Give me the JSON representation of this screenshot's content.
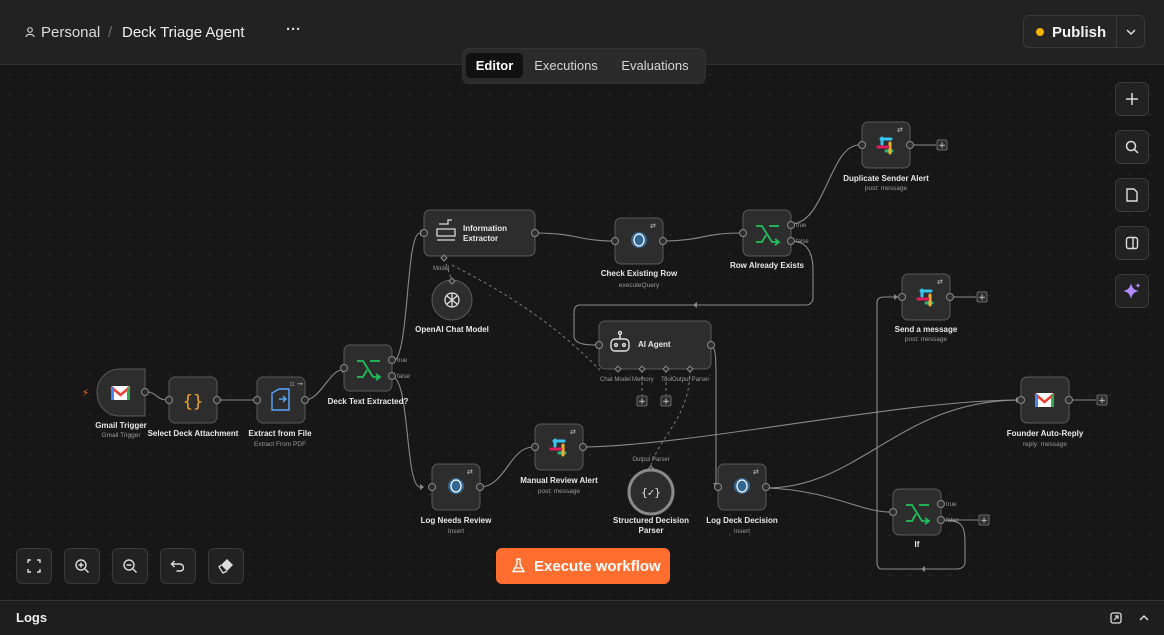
{
  "header": {
    "workspace_label": "Personal",
    "separator": "/",
    "workflow_name": "Deck Triage Agent",
    "more_label": "···",
    "publish_label": "Publish",
    "publish_status_color": "#f5b400"
  },
  "tabs": [
    {
      "label": "Editor",
      "active": true
    },
    {
      "label": "Executions",
      "active": false
    },
    {
      "label": "Evaluations",
      "active": false
    }
  ],
  "nodes": {
    "gmail_trigger": {
      "label": "Gmail Trigger",
      "sub": "Gmail Trigger",
      "icon": "gmail-icon"
    },
    "select_deck": {
      "label": "Select Deck Attachment",
      "icon": "code-braces-icon"
    },
    "extract_file": {
      "label": "Extract from File",
      "sub": "Extract From PDF",
      "icon": "file-extract-icon"
    },
    "deck_text_if": {
      "label": "Deck Text Extracted?",
      "icon": "if-branch-icon",
      "ports": [
        "true",
        "false"
      ]
    },
    "info_extractor": {
      "label1": "Information",
      "label2": "Extractor",
      "icon": "extractor-icon",
      "port": "Model"
    },
    "openai_model": {
      "label": "OpenAI Chat Model",
      "icon": "openai-icon"
    },
    "check_row": {
      "label": "Check Existing Row",
      "sub": "executeQuery",
      "icon": "postgres-icon"
    },
    "row_exists_if": {
      "label": "Row Already Exists",
      "icon": "if-branch-icon",
      "ports": [
        "true",
        "false"
      ]
    },
    "dup_alert": {
      "label": "Duplicate Sender Alert",
      "sub": "post: message",
      "icon": "slack-icon"
    },
    "ai_agent": {
      "label": "AI Agent",
      "icon": "robot-icon",
      "ports": [
        "Chat Model",
        "Memory",
        "Tool",
        "Output Parser"
      ]
    },
    "send_message": {
      "label": "Send a message",
      "sub": "post: message",
      "icon": "slack-icon"
    },
    "founder_reply": {
      "label": "Founder Auto-Reply",
      "sub": "reply: message",
      "icon": "gmail-icon"
    },
    "log_needs_review": {
      "label": "Log Needs Review",
      "sub": "Insert",
      "icon": "postgres-icon"
    },
    "manual_alert": {
      "label": "Manual Review Alert",
      "sub": "post: message",
      "icon": "slack-icon"
    },
    "structured_parser": {
      "label1": "Structured Decision",
      "label2": "Parser",
      "port": "Output Parser",
      "icon": "braces-parser-icon"
    },
    "log_decision": {
      "label": "Log Deck Decision",
      "sub": "Insert",
      "icon": "postgres-icon"
    },
    "if_node": {
      "label": "If",
      "icon": "if-branch-icon",
      "ports": [
        "true",
        "false"
      ]
    }
  },
  "canvas_controls": [
    "add-node",
    "search",
    "sticky-note",
    "toggle-panel",
    "ai-assistant"
  ],
  "bottom_controls": [
    "fit-view",
    "zoom-in",
    "zoom-out",
    "undo",
    "clear"
  ],
  "execute": {
    "label": "Execute workflow",
    "color": "#ff6d2f"
  },
  "logs": {
    "label": "Logs"
  }
}
